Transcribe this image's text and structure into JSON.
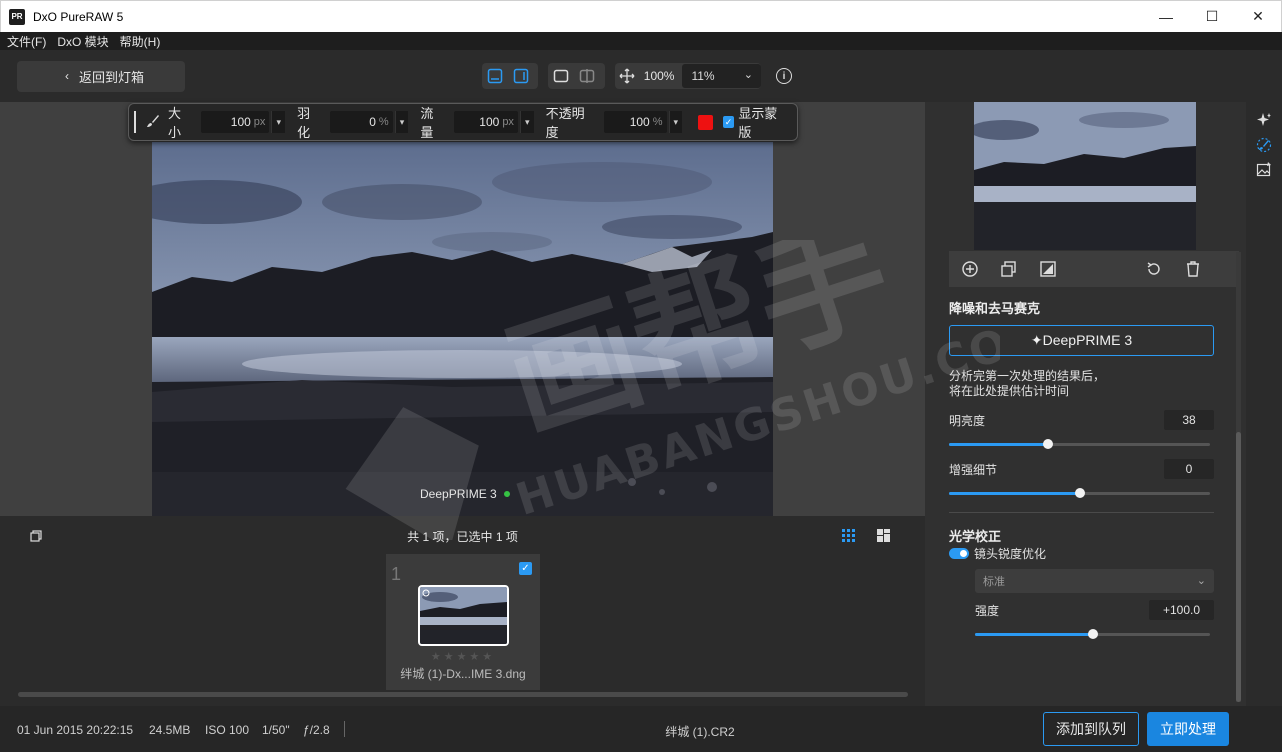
{
  "window": {
    "logo_text": "PR",
    "title": "DxO PureRAW 5",
    "minimize": "—",
    "maximize": "☐",
    "close": "✕"
  },
  "menu": [
    "文件(F)",
    "DxO 模块",
    "帮助(H)"
  ],
  "toolbar": {
    "back_label": "返回到灯箱",
    "zoom_fit_label": "100%",
    "zoom_select_value": "11%"
  },
  "brush_bar": {
    "size_label": "大小",
    "size_value": "100",
    "size_unit": "px",
    "feather_label": "羽化",
    "feather_value": "0",
    "feather_unit": "%",
    "flow_label": "流量",
    "flow_value": "100",
    "flow_unit": "px",
    "opacity_label": "不透明度",
    "opacity_value": "100",
    "opacity_unit": "%",
    "brush_color": "#ee1111",
    "show_mask_label": "显示蒙版"
  },
  "viewer": {
    "overlay_label": "DeepPRIME 3"
  },
  "filmstrip": {
    "count_text": "共 1 项，已选中 1 项",
    "thumb_index": "1",
    "thumb_name": "绊城 (1)-Dx...IME 3.dng",
    "stars": "★★★★★"
  },
  "right_panel": {
    "denoise_heading": "降噪和去马赛克",
    "deepprime_button": "✦DeepPRIME 3",
    "analysis_line1": "分析完第一次处理的结果后，",
    "analysis_line2": "将在此处提供估计时间",
    "luminance_label": "明亮度",
    "luminance_value": "38",
    "luminance_fraction": 0.38,
    "detail_label": "增强细节",
    "detail_value": "0",
    "detail_fraction": 0.5,
    "optics_heading": "光学校正",
    "lens_sharpness_label": "镜头锐度优化",
    "preset_value": "标准",
    "strength_label": "强度",
    "strength_value": "+100.0",
    "strength_fraction": 0.5
  },
  "status": {
    "date": "01 Jun 2015 20:22:15",
    "size": "24.5MB",
    "iso": "ISO 100",
    "shutter": "1/50\"",
    "aperture": "ƒ/2.8",
    "file_name": "绊城 (1).CR2",
    "add_queue_label": "添加到队列",
    "process_label": "立即处理"
  },
  "watermark": {
    "brand_cn": "画帮手",
    "brand_en": "HUABANGSHOU.COM"
  },
  "colors": {
    "accent": "#2b9af3",
    "panel": "#303030",
    "background": "#2b2b2b"
  }
}
